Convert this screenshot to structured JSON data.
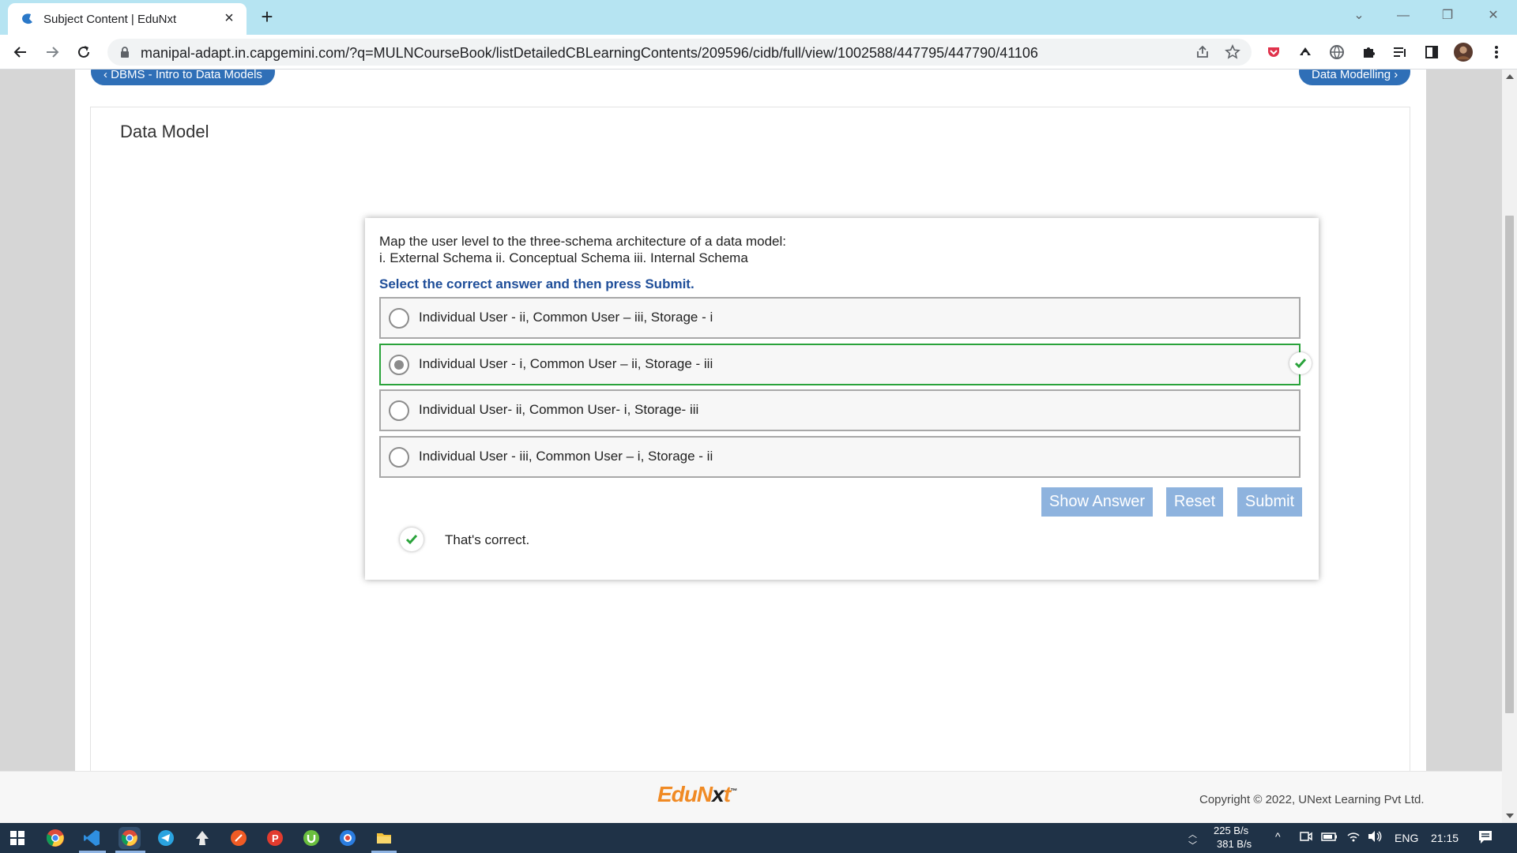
{
  "browser": {
    "tab_title": "Subject Content | EduNxt",
    "url": "manipal-adapt.in.capgemini.com/?q=MULNCourseBook/listDetailedCBLearningContents/209596/cidb/full/view/1002588/447795/447790/41106"
  },
  "page": {
    "prev_link": "‹ DBMS - Intro to Data Models",
    "next_link": "Data Modelling ›",
    "panel_title": "Data Model"
  },
  "quiz": {
    "question_line1": "Map the user level to the three-schema architecture of a data model:",
    "question_line2": "i. External Schema ii. Conceptual Schema iii. Internal Schema",
    "instruction": "Select the correct answer and then press Submit.",
    "options": [
      {
        "label": "Individual User - ii, Common User – iii, Storage - i",
        "selected": false,
        "correct": false
      },
      {
        "label": "Individual User - i, Common User – ii, Storage - iii",
        "selected": true,
        "correct": true
      },
      {
        "label": "Individual User- ii, Common User- i, Storage- iii",
        "selected": false,
        "correct": false
      },
      {
        "label": "Individual User - iii, Common User – i, Storage - ii",
        "selected": false,
        "correct": false
      }
    ],
    "buttons": {
      "show_answer": "Show Answer",
      "reset": "Reset",
      "submit": "Submit"
    },
    "feedback": "That's correct."
  },
  "footer": {
    "logo_part1": "EduN",
    "logo_part2": "x",
    "logo_part3": "t",
    "logo_tm": "™",
    "copyright": "Copyright © 2022, UNext Learning Pvt Ltd."
  },
  "taskbar": {
    "net_up": "225 B/s",
    "net_down": "381 B/s",
    "language": "ENG",
    "time": "21:15"
  },
  "colors": {
    "tabstrip": "#b6e4f2",
    "link_pill": "#2f6fb7",
    "instruction": "#1f4e99",
    "correct_border": "#2aa33b",
    "button": "#8eb3de",
    "brand_orange": "#f08a24",
    "taskbar": "#1f3247"
  }
}
